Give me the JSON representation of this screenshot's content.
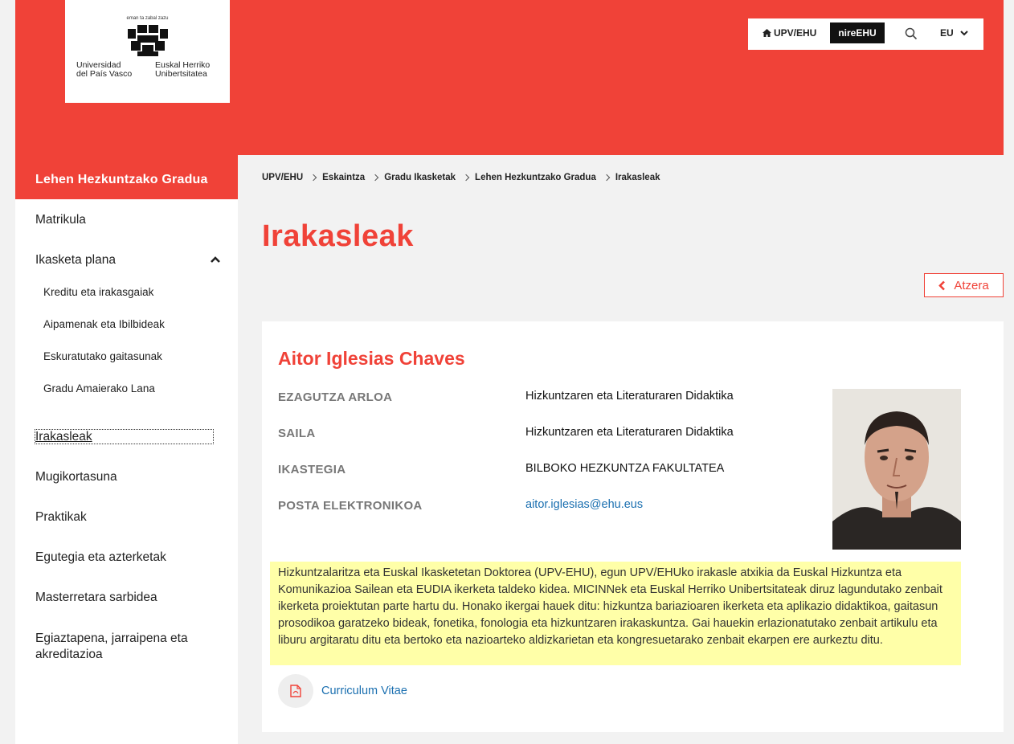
{
  "logo": {
    "motto": "eman ta zabal zazu",
    "name_es": "Universidad del País Vasco",
    "name_es_line1": "Universidad",
    "name_es_line2": "del País Vasco",
    "name_eu_line1": "Euskal Herriko",
    "name_eu_line2": "Unibertsitatea"
  },
  "toolbar": {
    "home_label": "UPV/EHU",
    "nire_label": "nireEHU",
    "search_icon": "search-icon",
    "lang_label": "EU"
  },
  "sidebar": {
    "title": "Lehen Hezkuntzako Gradua",
    "items": [
      {
        "label": "Matrikula"
      },
      {
        "label": "Ikasketa plana"
      },
      {
        "label": "Irakasleak"
      },
      {
        "label": "Mugikortasuna"
      },
      {
        "label": "Praktikak"
      },
      {
        "label": "Egutegia eta azterketak"
      },
      {
        "label": "Masterretara sarbidea"
      },
      {
        "label": "Egiaztapena, jarraipena eta akreditazioa"
      }
    ],
    "subitems": [
      {
        "label": "Kreditu eta irakasgaiak"
      },
      {
        "label": "Aipamenak eta Ibilbideak"
      },
      {
        "label": "Eskuratutako gaitasunak"
      },
      {
        "label": "Gradu Amaierako Lana"
      }
    ]
  },
  "breadcrumb": [
    "UPV/EHU",
    "Eskaintza",
    "Gradu Ikasketak",
    "Lehen Hezkuntzako Gradua",
    "Irakasleak"
  ],
  "page": {
    "title": "Irakasleak",
    "back_label": "Atzera"
  },
  "person": {
    "name": "Aitor Iglesias Chaves",
    "fields": [
      {
        "label": "EZAGUTZA ARLOA",
        "value": "Hizkuntzaren eta Literaturaren Didaktika"
      },
      {
        "label": "SAILA",
        "value": "Hizkuntzaren eta Literaturaren Didaktika"
      },
      {
        "label": "IKASTEGIA",
        "value": "BILBOKO HEZKUNTZA FAKULTATEA"
      },
      {
        "label": "POSTA ELEKTRONIKOA",
        "value": "aitor.iglesias@ehu.eus"
      }
    ],
    "bio": "Hizkuntzalaritza eta Euskal Ikasketetan Doktorea (UPV-EHU), egun UPV/EHUko irakasle atxikia da Euskal Hizkuntza eta Komunikazioa Sailean eta EUDIA ikerketa taldeko kidea. MICINNek eta Euskal Herriko Unibertsitateak diruz lagundutako zenbait ikerketa proiektutan parte hartu du. Honako ikergai hauek ditu: hizkuntza bariazioaren ikerketa eta aplikazio didaktikoa, gaitasun prosodikoa garatzeko bideak, fonetika, fonologia eta hizkuntzaren irakaskuntza. Gai hauekin erlazionatutako zenbait artikulu eta liburu argitaratu ditu eta bertoko eta nazioarteko aldizkarietan eta kongresuetarako zenbait ekarpen ere aurkeztu ditu.",
    "cv_label": "Curriculum Vitae"
  },
  "colors": {
    "brand_red": "#f04238",
    "bio_highlight": "#ffffa8",
    "link_blue": "#1a6fb0"
  }
}
